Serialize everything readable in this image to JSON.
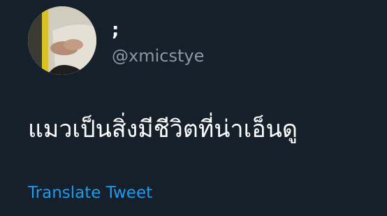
{
  "user": {
    "display_name": ";",
    "handle": "@xmicstye"
  },
  "tweet": {
    "text": "แมวเป็นสิ่งมีชีวิตที่น่าเอ็นดู",
    "translate_label": "Translate Tweet"
  },
  "colors": {
    "background": "#15202b",
    "text_primary": "#ffffff",
    "text_secondary": "#8899a6",
    "link": "#1d9bf0"
  }
}
